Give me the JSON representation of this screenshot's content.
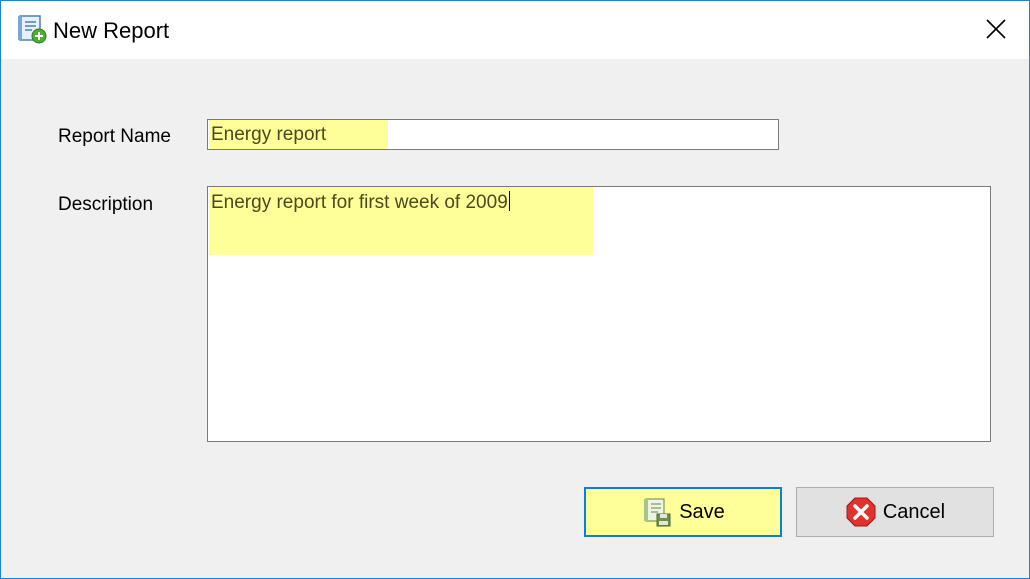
{
  "window": {
    "title": "New Report",
    "title_icon": "new-report-icon",
    "close_icon": "close-icon"
  },
  "form": {
    "report_name_label": "Report Name",
    "report_name_value": "Energy report",
    "description_label": "Description",
    "description_value": "Energy report for first week of 2009"
  },
  "buttons": {
    "save_label": "Save",
    "save_icon": "save-report-icon",
    "cancel_label": "Cancel",
    "cancel_icon": "cancel-x-icon"
  },
  "colors": {
    "highlight": "#ffff99",
    "window_border": "#1883d7",
    "focus_border": "#0a7fd8",
    "cancel_red": "#e0322f"
  }
}
